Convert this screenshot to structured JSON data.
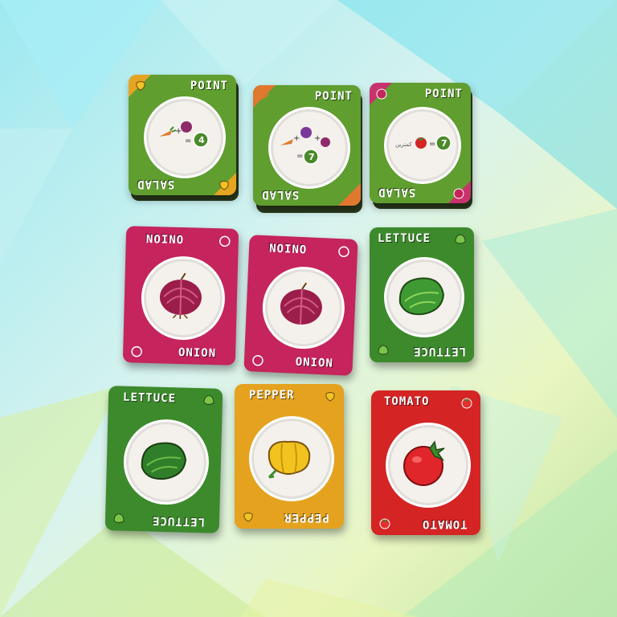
{
  "point_cards": [
    {
      "title": "POINT",
      "subtitle": "SALAD",
      "formula_result": "4",
      "corner_color": "#e6a423",
      "ops": "+",
      "equals": "="
    },
    {
      "title": "POINT",
      "subtitle": "SALAD",
      "formula_result": "7",
      "corner_color": "#e07830",
      "ops": "+",
      "equals": "="
    },
    {
      "title": "POINT",
      "subtitle": "SALAD",
      "formula_result": "7",
      "corner_color": "#c8326d",
      "ops": "",
      "equals": "=",
      "small_text": "كمترين"
    }
  ],
  "veg_cards": [
    {
      "name": "ONION",
      "color": "#c5245d",
      "veg": "onion"
    },
    {
      "name": "ONION",
      "color": "#c5245d",
      "veg": "onion"
    },
    {
      "name": "LETTUCE",
      "color": "#3c8a2c",
      "veg": "lettuce"
    },
    {
      "name": "LETTUCE",
      "color": "#3c8a2c",
      "veg": "lettuce"
    },
    {
      "name": "PEPPER",
      "color": "#e4a21f",
      "veg": "pepper"
    },
    {
      "name": "TOMATO",
      "color": "#d42424",
      "veg": "tomato"
    }
  ],
  "colors": {
    "point_green": "#5f9e2f",
    "onion": "#c5245d",
    "lettuce": "#3c8a2c",
    "pepper": "#e4a21f",
    "tomato": "#d42424"
  }
}
